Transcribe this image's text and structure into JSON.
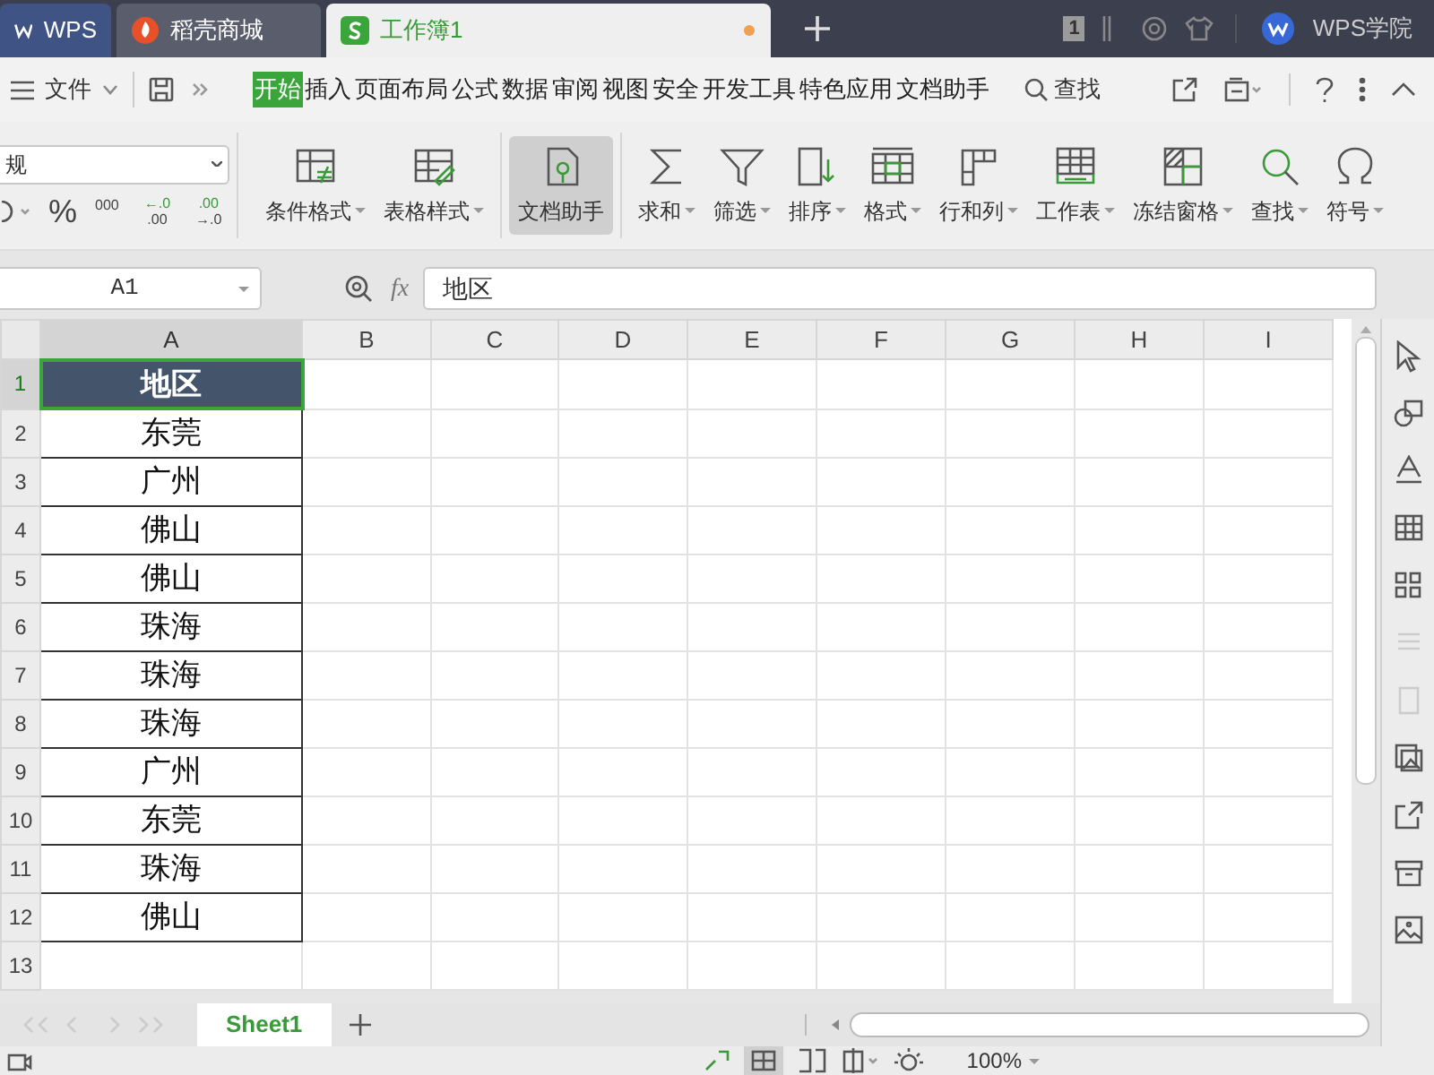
{
  "app_tabs": [
    {
      "label": "WPS",
      "kind": "home",
      "selected": false
    },
    {
      "label": "稻壳商城",
      "kind": "store",
      "selected": false
    },
    {
      "label": "工作簿1",
      "kind": "sheet",
      "selected": true
    }
  ],
  "title_bar": {
    "badge": "1",
    "account": "WPS学院"
  },
  "menu": {
    "file": "文件",
    "search": "查找",
    "tabs": [
      {
        "label": "开始",
        "selected": true
      },
      {
        "label": "插入",
        "selected": false
      },
      {
        "label": "页面布局",
        "selected": false
      },
      {
        "label": "公式",
        "selected": false
      },
      {
        "label": "数据",
        "selected": false
      },
      {
        "label": "审阅",
        "selected": false
      },
      {
        "label": "视图",
        "selected": false
      },
      {
        "label": "安全",
        "selected": false
      },
      {
        "label": "开发工具",
        "selected": false
      },
      {
        "label": "特色应用",
        "selected": false
      },
      {
        "label": "文档助手",
        "selected": false
      }
    ]
  },
  "ribbon": {
    "number_format": "规",
    "number_buttons": [
      {
        "kind": "currency"
      },
      {
        "kind": "percent",
        "label": "%"
      },
      {
        "kind": "thousands",
        "label": "000"
      },
      {
        "kind": "increase",
        "top": "←.0",
        "bottom": ".00"
      },
      {
        "kind": "decrease",
        "top": ".00",
        "bottom": "→.0"
      }
    ],
    "groups": [
      {
        "label": "条件格式",
        "kind": "conditional",
        "dropdown": true,
        "selected": false
      },
      {
        "label": "表格样式",
        "kind": "table-style",
        "dropdown": true,
        "selected": false
      },
      {
        "label": "文档助手",
        "kind": "assistant",
        "dropdown": false,
        "selected": true
      },
      {
        "label": "求和",
        "kind": "sum",
        "dropdown": true,
        "selected": false
      },
      {
        "label": "筛选",
        "kind": "filter",
        "dropdown": true,
        "selected": false
      },
      {
        "label": "排序",
        "kind": "sort",
        "dropdown": true,
        "selected": false
      },
      {
        "label": "格式",
        "kind": "format",
        "dropdown": true,
        "selected": false
      },
      {
        "label": "行和列",
        "kind": "rowcol",
        "dropdown": true,
        "selected": false
      },
      {
        "label": "工作表",
        "kind": "worksheet",
        "dropdown": true,
        "selected": false
      },
      {
        "label": "冻结窗格",
        "kind": "freeze",
        "dropdown": true,
        "selected": false
      },
      {
        "label": "查找",
        "kind": "find",
        "dropdown": true,
        "selected": false
      },
      {
        "label": "符号",
        "kind": "symbol",
        "dropdown": true,
        "selected": false
      }
    ]
  },
  "formula_bar": {
    "name_box": "A1",
    "fx": "fx",
    "value": "地区"
  },
  "sheet": {
    "columns": [
      "A",
      "B",
      "C",
      "D",
      "E",
      "F",
      "G",
      "H",
      "I"
    ],
    "rows": [
      {
        "number": "1",
        "value": "地区",
        "kind": "header",
        "selected": true
      },
      {
        "number": "2",
        "value": "东莞",
        "kind": "data",
        "selected": false
      },
      {
        "number": "3",
        "value": "广州",
        "kind": "data",
        "selected": false
      },
      {
        "number": "4",
        "value": "佛山",
        "kind": "data",
        "selected": false
      },
      {
        "number": "5",
        "value": "佛山",
        "kind": "data",
        "selected": false
      },
      {
        "number": "6",
        "value": "珠海",
        "kind": "data",
        "selected": false
      },
      {
        "number": "7",
        "value": "珠海",
        "kind": "data",
        "selected": false
      },
      {
        "number": "8",
        "value": "珠海",
        "kind": "data",
        "selected": false
      },
      {
        "number": "9",
        "value": "广州",
        "kind": "data",
        "selected": false
      },
      {
        "number": "10",
        "value": "东莞",
        "kind": "data",
        "selected": false
      },
      {
        "number": "11",
        "value": "珠海",
        "kind": "data",
        "selected": false
      },
      {
        "number": "12",
        "value": "佛山",
        "kind": "data",
        "selected": false
      },
      {
        "number": "13",
        "kind": "empty",
        "selected": false
      }
    ]
  },
  "sheet_tabs": [
    {
      "label": "Sheet1",
      "selected": true
    }
  ],
  "status_bar": {
    "zoom": "100%"
  }
}
